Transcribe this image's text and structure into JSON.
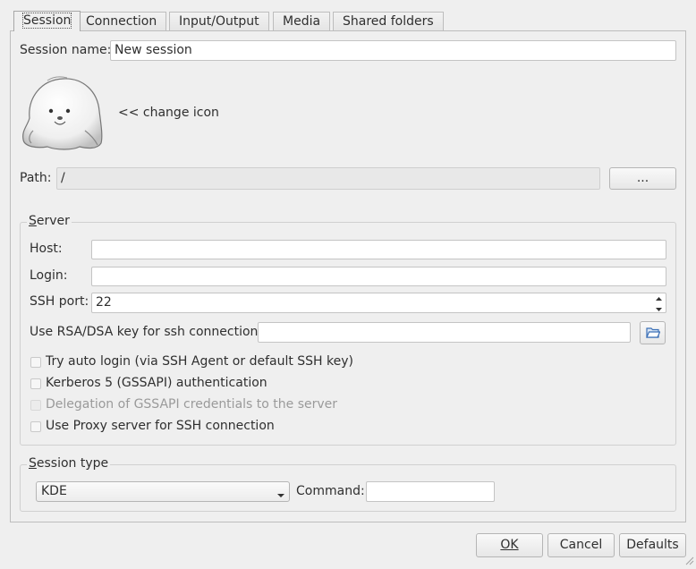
{
  "tabs": [
    {
      "label": "Session"
    },
    {
      "label": "Connection"
    },
    {
      "label": "Input/Output"
    },
    {
      "label": "Media"
    },
    {
      "label": "Shared folders"
    }
  ],
  "session": {
    "name_label": "Session name:",
    "name_value": "New session",
    "change_icon_label": "<< change icon",
    "path_label": "Path:",
    "path_value": "/",
    "path_button": "..."
  },
  "server": {
    "title": "Server",
    "host_label": "Host:",
    "host_value": "",
    "login_label": "Login:",
    "login_value": "",
    "ssh_port_label": "SSH port:",
    "ssh_port_value": "22",
    "rsa_label": "Use RSA/DSA key for ssh connection:",
    "rsa_value": "",
    "checkboxes": [
      {
        "label": "Try auto login (via SSH Agent or default SSH key)",
        "checked": false,
        "enabled": true
      },
      {
        "label": "Kerberos 5 (GSSAPI) authentication",
        "checked": false,
        "enabled": true
      },
      {
        "label": "Delegation of GSSAPI credentials to the server",
        "checked": false,
        "enabled": false
      },
      {
        "label": "Use Proxy server for SSH connection",
        "checked": false,
        "enabled": true
      }
    ]
  },
  "session_type": {
    "title": "Session type",
    "selected": "KDE",
    "command_label": "Command:",
    "command_value": ""
  },
  "buttons": {
    "ok": "OK",
    "cancel": "Cancel",
    "defaults": "Defaults"
  },
  "icons": {
    "session_icon": "seal-icon",
    "folder": "folder-open-icon",
    "spin_up": "spin-up-icon",
    "spin_down": "spin-down-icon",
    "dropdown": "chevron-down-icon",
    "resize": "resize-grip-icon"
  }
}
